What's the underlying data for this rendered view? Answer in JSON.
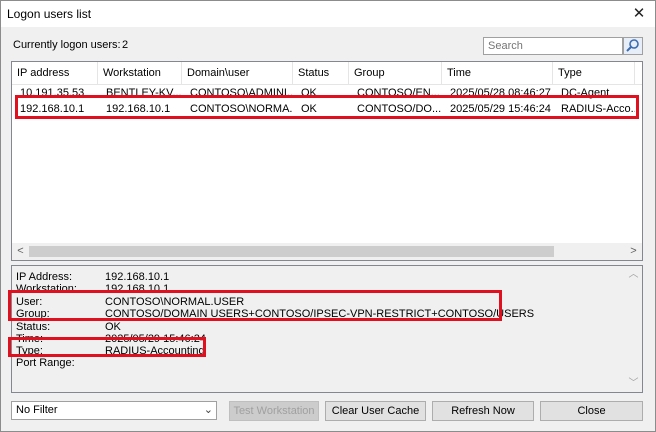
{
  "window": {
    "title": "Logon users list"
  },
  "summary": {
    "label": "Currently logon users:",
    "count": "2"
  },
  "search": {
    "placeholder": "Search"
  },
  "columns": [
    "IP address",
    "Workstation",
    "Domain\\user",
    "Status",
    "Group",
    "Time",
    "Type"
  ],
  "rows": [
    [
      "10.191.35.53",
      "BENTLEY-KV...",
      "CONTOSO\\ADMINI...",
      "OK",
      "CONTOSO/EN...",
      "2025/05/28 08:46:27",
      "DC-Agent"
    ],
    [
      "192.168.10.1",
      "192.168.10.1",
      "CONTOSO\\NORMA...",
      "OK",
      "CONTOSO/DO...",
      "2025/05/29 15:46:24",
      "RADIUS-Acco..."
    ]
  ],
  "details": [
    {
      "label": "IP Address:",
      "value": "192.168.10.1"
    },
    {
      "label": "Workstation:",
      "value": "192.168.10.1"
    },
    {
      "label": "User:",
      "value": "CONTOSO\\NORMAL.USER"
    },
    {
      "label": "Group:",
      "value": "CONTOSO/DOMAIN USERS+CONTOSO/IPSEC-VPN-RESTRICT+CONTOSO/USERS"
    },
    {
      "label": "Status:",
      "value": "OK"
    },
    {
      "label": "Time:",
      "value": "2025/05/29 15:46:24"
    },
    {
      "label": "Type:",
      "value": "RADIUS-Accounting"
    },
    {
      "label": "Port Range:",
      "value": ""
    }
  ],
  "filter": {
    "selected": "No Filter"
  },
  "buttons": {
    "test_workstation": "Test Workstation",
    "clear_cache": "Clear User Cache",
    "refresh": "Refresh Now",
    "close": "Close"
  },
  "highlight_color": "#e0101e"
}
